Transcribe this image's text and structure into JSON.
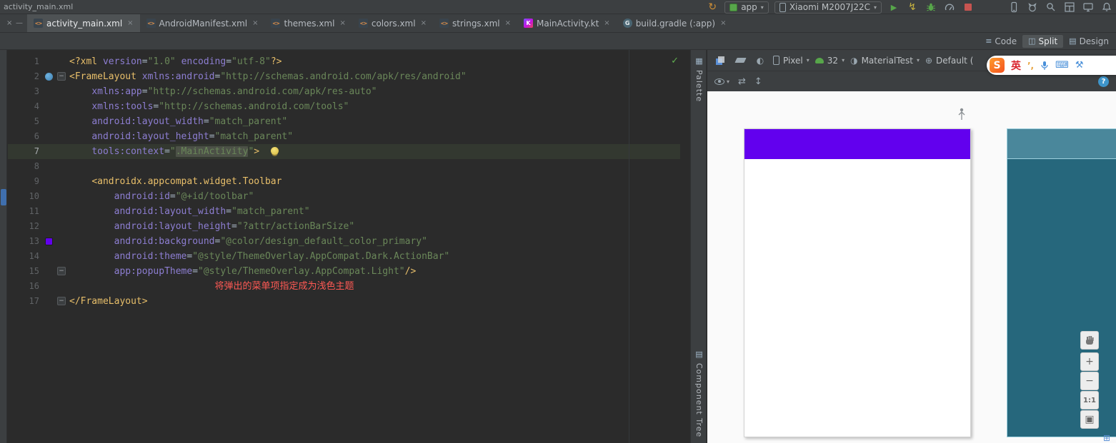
{
  "window": {
    "title": "activity_main.xml"
  },
  "run_bar": {
    "config_label": "app",
    "device_label": "Xiaomi M2007J22C"
  },
  "tabs": [
    {
      "label": "activity_main.xml",
      "kind": "xml",
      "selected": true
    },
    {
      "label": "AndroidManifest.xml",
      "kind": "xml",
      "selected": false
    },
    {
      "label": "themes.xml",
      "kind": "xml",
      "selected": false
    },
    {
      "label": "colors.xml",
      "kind": "xml",
      "selected": false
    },
    {
      "label": "strings.xml",
      "kind": "xml",
      "selected": false
    },
    {
      "label": "MainActivity.kt",
      "kind": "kotlin",
      "selected": false
    },
    {
      "label": "build.gradle (:app)",
      "kind": "gradle",
      "selected": false
    }
  ],
  "mode_switcher": {
    "options": [
      "Code",
      "Split",
      "Design"
    ],
    "active": "Split"
  },
  "editor": {
    "current_line": 7,
    "folds": [
      2,
      15,
      17
    ],
    "gutter_icons": [
      {
        "line": 2,
        "type": "related"
      },
      {
        "line": 13,
        "type": "color"
      }
    ],
    "lines": [
      {
        "n": 1,
        "tokens": [
          [
            "tag",
            "<?xml "
          ],
          [
            "attr",
            "version"
          ],
          [
            "pln",
            "="
          ],
          [
            "str",
            "\"1.0\""
          ],
          [
            "pln",
            " "
          ],
          [
            "attr",
            "encoding"
          ],
          [
            "pln",
            "="
          ],
          [
            "str",
            "\"utf-8\""
          ],
          [
            "tag",
            "?>"
          ]
        ]
      },
      {
        "n": 2,
        "tokens": [
          [
            "tag",
            "<FrameLayout "
          ],
          [
            "attr",
            "xmlns:android"
          ],
          [
            "pln",
            "="
          ],
          [
            "str",
            "\"http://schemas.android.com/apk/res/android\""
          ]
        ]
      },
      {
        "n": 3,
        "tokens": [
          [
            "pln",
            "    "
          ],
          [
            "attr",
            "xmlns:app"
          ],
          [
            "pln",
            "="
          ],
          [
            "str",
            "\"http://schemas.android.com/apk/res-auto\""
          ]
        ]
      },
      {
        "n": 4,
        "tokens": [
          [
            "pln",
            "    "
          ],
          [
            "attr",
            "xmlns:tools"
          ],
          [
            "pln",
            "="
          ],
          [
            "str",
            "\"http://schemas.android.com/tools\""
          ]
        ]
      },
      {
        "n": 5,
        "tokens": [
          [
            "pln",
            "    "
          ],
          [
            "attr",
            "android:layout_width"
          ],
          [
            "pln",
            "="
          ],
          [
            "str",
            "\"match_parent\""
          ]
        ]
      },
      {
        "n": 6,
        "tokens": [
          [
            "pln",
            "    "
          ],
          [
            "attr",
            "android:layout_height"
          ],
          [
            "pln",
            "="
          ],
          [
            "str",
            "\"match_parent\""
          ]
        ]
      },
      {
        "n": 7,
        "bulb": true,
        "tokens": [
          [
            "pln",
            "    "
          ],
          [
            "attr",
            "tools:context"
          ],
          [
            "pln",
            "="
          ],
          [
            "str",
            "\""
          ],
          [
            "hl",
            ".MainActivity"
          ],
          [
            "str",
            "\""
          ],
          [
            "tag",
            ">"
          ]
        ]
      },
      {
        "n": 8,
        "tokens": []
      },
      {
        "n": 9,
        "tokens": [
          [
            "pln",
            "    "
          ],
          [
            "tag",
            "<androidx.appcompat.widget.Toolbar"
          ]
        ]
      },
      {
        "n": 10,
        "tokens": [
          [
            "pln",
            "        "
          ],
          [
            "attr",
            "android:id"
          ],
          [
            "pln",
            "="
          ],
          [
            "str",
            "\"@+id/toolbar\""
          ]
        ]
      },
      {
        "n": 11,
        "tokens": [
          [
            "pln",
            "        "
          ],
          [
            "attr",
            "android:layout_width"
          ],
          [
            "pln",
            "="
          ],
          [
            "str",
            "\"match_parent\""
          ]
        ]
      },
      {
        "n": 12,
        "tokens": [
          [
            "pln",
            "        "
          ],
          [
            "attr",
            "android:layout_height"
          ],
          [
            "pln",
            "="
          ],
          [
            "str",
            "\"?attr/actionBarSize\""
          ]
        ]
      },
      {
        "n": 13,
        "tokens": [
          [
            "pln",
            "        "
          ],
          [
            "attr",
            "android:background"
          ],
          [
            "pln",
            "="
          ],
          [
            "str",
            "\"@color/design_default_color_primary\""
          ]
        ]
      },
      {
        "n": 14,
        "tokens": [
          [
            "pln",
            "        "
          ],
          [
            "attr",
            "android:theme"
          ],
          [
            "pln",
            "="
          ],
          [
            "str",
            "\"@style/ThemeOverlay.AppCompat.Dark.ActionBar\""
          ]
        ]
      },
      {
        "n": 15,
        "tokens": [
          [
            "pln",
            "        "
          ],
          [
            "attr",
            "app:popupTheme"
          ],
          [
            "pln",
            "="
          ],
          [
            "str",
            "\"@style/ThemeOverlay.AppCompat.Light\""
          ],
          [
            "tag",
            "/>"
          ]
        ]
      },
      {
        "n": 16,
        "tokens": [
          [
            "pln",
            "                          "
          ],
          [
            "err",
            "将弹出的菜单项指定成为浅色主题"
          ]
        ]
      },
      {
        "n": 17,
        "tokens": [
          [
            "tag",
            "</FrameLayout>"
          ]
        ]
      }
    ]
  },
  "design": {
    "left_strip": {
      "top_label": "Palette",
      "bottom_label": "Component Tree"
    },
    "toolbar": {
      "device": "Pixel",
      "api_level": "32",
      "theme": "MaterialTest",
      "locale": "Default ("
    },
    "zoom": {
      "one_to_one": "1:1"
    }
  },
  "ime_bar": {
    "brand": "S",
    "lang_mode": "英",
    "punct": "’,"
  },
  "icons": {
    "close": "×",
    "minimize": "—",
    "caret": "▾",
    "sync": "↻",
    "run": "▶",
    "apply_changes": "↯",
    "check": "✓",
    "mode_code": "≡",
    "mode_split": "◫",
    "mode_design": "▤",
    "fold": "−",
    "file_xml": "<>",
    "file_kotlin": "K",
    "file_gradle": "G",
    "palette_icon": "▦",
    "tree_icon": "▤",
    "night": "◐",
    "theme_circle": "◑",
    "globe": "⊕",
    "swap_h": "⇄",
    "swap_v": "↕",
    "help": "?",
    "zoom_in": "+",
    "zoom_out": "−",
    "zoom_fit": "▣",
    "keyboard": "⌨",
    "toolbox": "⚒",
    "apps_grid": "⊞"
  },
  "colors": {
    "primary_purple": "#6200EE",
    "blueprint_body": "#26677C",
    "blueprint_header": "#4A879B",
    "blueprint_outline": "#9ED0DE",
    "error_red": "#FF5954",
    "string_green": "#6A8759",
    "tag_yellow": "#E8BF6A",
    "attr_purple": "#8D7ED2",
    "run_green": "#57A64A",
    "stop_red": "#C75450"
  }
}
